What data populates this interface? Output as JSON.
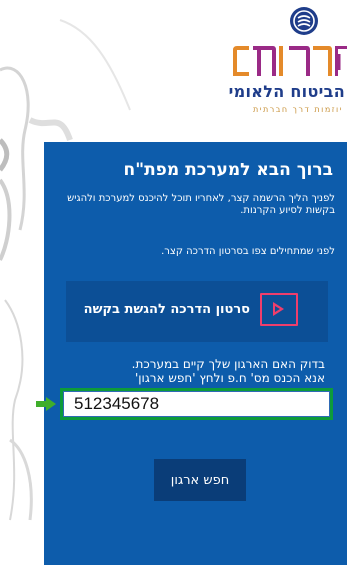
{
  "logo": {
    "emblem_icon": "national-insurance-emblem-icon",
    "wordmark": "קרנות",
    "subtitle": "הביטוח הלאומי",
    "tagline": "יוזמות דרך חברתית",
    "colors": {
      "wordmark_primary": "#9a2a86",
      "wordmark_secondary": "#e48a2a",
      "subtitle": "#1f3d8a",
      "tagline": "#c9943d"
    }
  },
  "panel": {
    "background": "#0d5cab",
    "title": "ברוך הבא למערכת מפת\"ח",
    "intro": "לפניך הליך הרשמה קצר, לאחריו תוכל להיכנס למערכת ולהגיש בקשות לסיוע הקרנות.",
    "video_note": "לפני שמתחילים צפו בסרטון הדרכה קצר.",
    "video_banner": {
      "label": "סרטון הדרכה להגשת בקשה",
      "icon": "video-play-icon",
      "icon_color": "#ef3e6c"
    },
    "check_line1": "בדוק האם הארגון שלך קיים במערכת.",
    "check_line2": "אנא הכנס מס' ח.פ ולחץ 'חפש ארגון'",
    "org_number_input": {
      "value": "512345678",
      "placeholder": "",
      "highlight_color": "#0d9b3a"
    },
    "search_button_label": "חפש ארגון"
  },
  "pointer": {
    "icon": "green-arrow-icon",
    "color": "#3fae2a"
  }
}
